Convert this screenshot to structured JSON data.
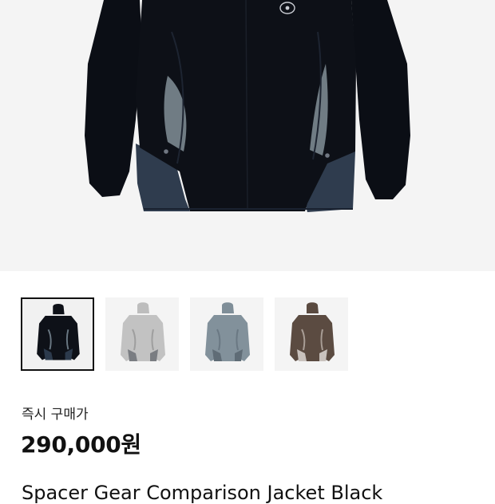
{
  "product": {
    "buy_now_label": "즉시 구매가",
    "price": "290,000원",
    "title": "Spacer Gear Comparison Jacket Black"
  },
  "gallery": {
    "thumbnails": [
      {
        "color_name": "black",
        "body": "#0e1118",
        "panel": "#2c3a4c",
        "selected": true
      },
      {
        "color_name": "light-grey",
        "body": "#bdbdbd",
        "panel": "#9e9e9e",
        "selected": false
      },
      {
        "color_name": "blue-grey",
        "body": "#7f8e98",
        "panel": "#6a7883",
        "selected": false
      },
      {
        "color_name": "brown",
        "body": "#5a4a40",
        "panel": "#c9c2bd",
        "selected": false
      }
    ]
  },
  "colors": {
    "hero_background": "#f4f4f4",
    "jacket_body": "#0c0f16",
    "jacket_side_panel": "#2f3c4e",
    "jacket_insert": "#6e7a82"
  }
}
